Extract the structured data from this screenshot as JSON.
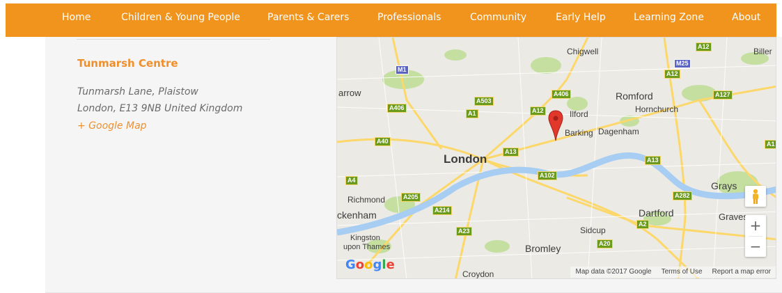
{
  "nav": {
    "items": [
      "Home",
      "Children & Young People",
      "Parents & Carers",
      "Professionals",
      "Community",
      "Early Help",
      "Learning Zone",
      "About"
    ]
  },
  "venue": {
    "title": "Tunmarsh Centre",
    "address_line1": "Tunmarsh Lane, Plaistow",
    "address_line2": "London, E13 9NB United Kingdom",
    "map_link": "+ Google Map"
  },
  "map": {
    "places": [
      "Chigwell",
      "Biller",
      "arrow",
      "Romford",
      "Ilford",
      "Hornchurch",
      "Barking",
      "Dagenham",
      "London",
      "Grays",
      "Richmond",
      "ckenham",
      "Dartford",
      "Graves",
      "Sidcup",
      "Kingston",
      "upon Thames",
      "Bromley",
      "Croydon"
    ],
    "shields": [
      "A12",
      "M25",
      "A12",
      "M1",
      "A406",
      "A127",
      "A503",
      "A406",
      "A1",
      "A12",
      "A40",
      "A13",
      "A1",
      "A13",
      "A102",
      "A4",
      "A205",
      "A282",
      "A214",
      "A2",
      "A23",
      "A20"
    ],
    "logo": "Google",
    "footer": {
      "attribution": "Map data ©2017 Google",
      "terms": "Terms of Use",
      "report": "Report a map error"
    },
    "zoom_in": "+",
    "zoom_out": "−",
    "colors": {
      "water": "#a7cdf2",
      "park": "#c4dfa0",
      "road_major": "#fcd76a",
      "marker": "#e2372b"
    }
  }
}
